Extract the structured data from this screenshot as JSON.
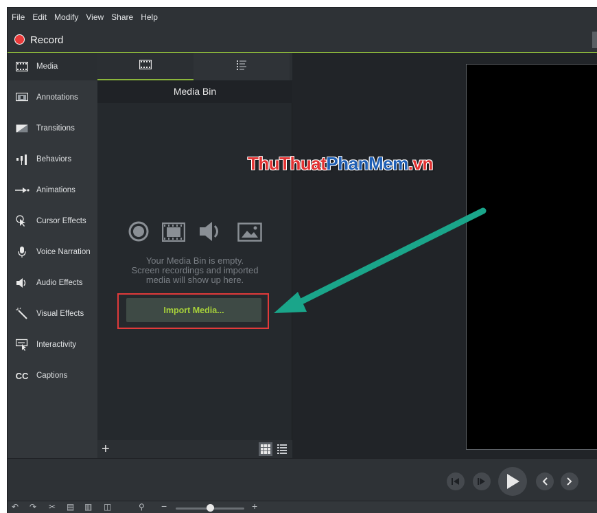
{
  "menu": [
    "File",
    "Edit",
    "Modify",
    "View",
    "Share",
    "Help"
  ],
  "record": {
    "label": "Record",
    "color": "#ea3a3a"
  },
  "sidebar": {
    "items": [
      {
        "label": "Media",
        "icon": "filmstrip-icon",
        "active": true
      },
      {
        "label": "Annotations",
        "icon": "annotation-icon"
      },
      {
        "label": "Transitions",
        "icon": "transition-icon"
      },
      {
        "label": "Behaviors",
        "icon": "behaviors-icon"
      },
      {
        "label": "Animations",
        "icon": "animation-arrow-icon"
      },
      {
        "label": "Cursor Effects",
        "icon": "cursor-effects-icon"
      },
      {
        "label": "Voice Narration",
        "icon": "microphone-icon"
      },
      {
        "label": "Audio Effects",
        "icon": "speaker-icon"
      },
      {
        "label": "Visual Effects",
        "icon": "magic-wand-icon"
      },
      {
        "label": "Interactivity",
        "icon": "interactivity-icon"
      },
      {
        "label": "Captions",
        "icon": "captions-cc-icon",
        "glyph": "CC"
      }
    ]
  },
  "media_panel": {
    "tabs": [
      {
        "icon": "filmstrip-icon",
        "active": true
      },
      {
        "icon": "list-icon",
        "active": false
      }
    ],
    "bin_title": "Media Bin",
    "empty_icons": [
      "record-icon",
      "video-icon",
      "audio-icon",
      "image-icon"
    ],
    "empty_text": [
      "Your Media Bin is empty.",
      "Screen recordings and imported",
      "media will show up here."
    ],
    "import_button": "Import Media...",
    "footer": {
      "add_icon": "plus-icon",
      "views": [
        "grid-view-icon",
        "list-view-icon"
      ]
    }
  },
  "watermark": {
    "part1": "ThuThuat",
    "part2": "PhanMem",
    "part3": ".vn"
  },
  "playback": [
    "step-back-icon",
    "previous-frame-icon",
    "play-icon",
    "previous-icon",
    "next-icon"
  ],
  "timeline": {
    "tools": [
      "undo-icon",
      "redo-icon",
      "cut-icon",
      "copy-icon",
      "paste-icon",
      "split-icon",
      "zoom-icon"
    ],
    "zoom_minus": "−",
    "zoom_plus": "+",
    "zoom_level": 0.5
  },
  "colors": {
    "accent": "#8bb63b",
    "import_text": "#a7d13a",
    "highlight": "#e23a3a",
    "arrow": "#1aa58a"
  }
}
